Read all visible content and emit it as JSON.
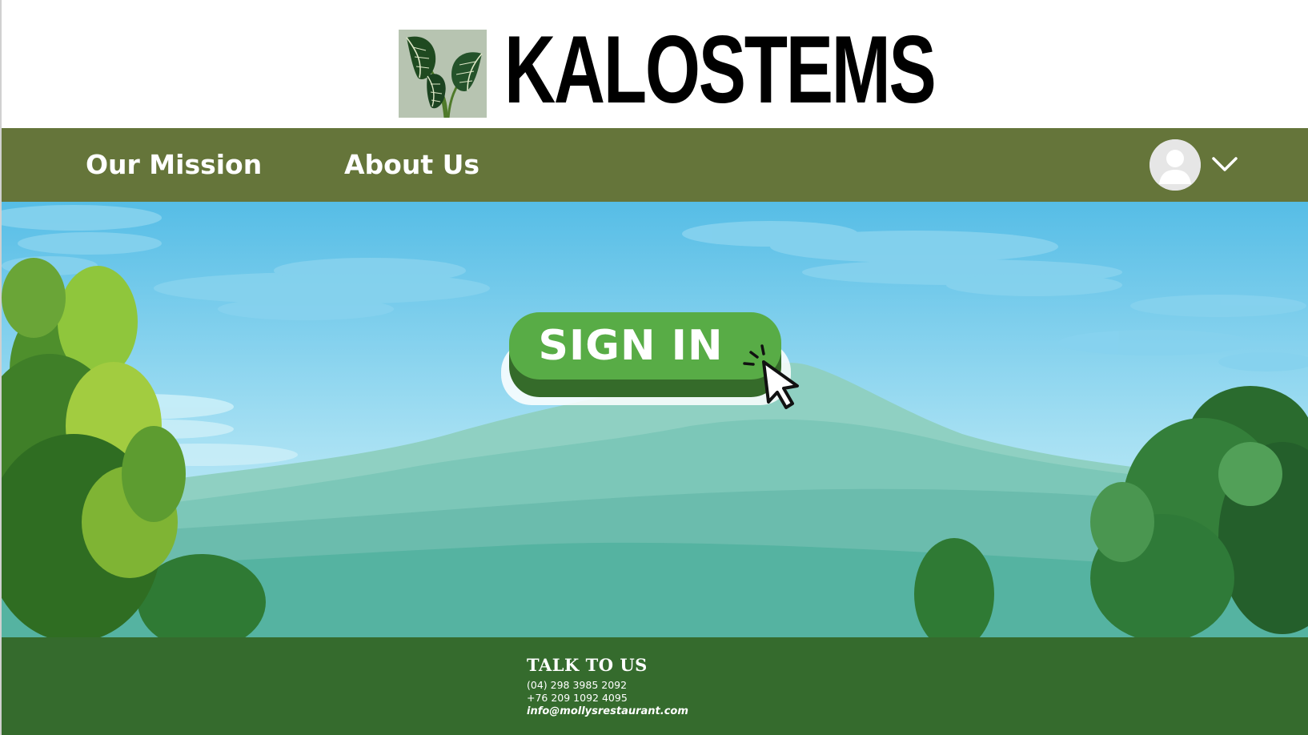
{
  "brand": {
    "name": "KALOSTEMS",
    "logo_icon": "alocasia-leaf-icon"
  },
  "nav": {
    "items": [
      {
        "label": "Our Mission"
      },
      {
        "label": "About Us"
      }
    ],
    "account_icon": "user-avatar-icon",
    "menu_icon": "chevron-down-icon",
    "bar_color": "#65753a"
  },
  "hero": {
    "signin_label": "SIGN IN",
    "cursor_icon": "hand-pointer-click-icon",
    "button_color": "#58ac46"
  },
  "footer": {
    "title": "TALK TO US",
    "phone1": "(04) 298 3985 2092",
    "phone2": "+76 209 1092 4095",
    "email": "info@mollysrestaurant.com",
    "bg_color": "#356b2d"
  }
}
